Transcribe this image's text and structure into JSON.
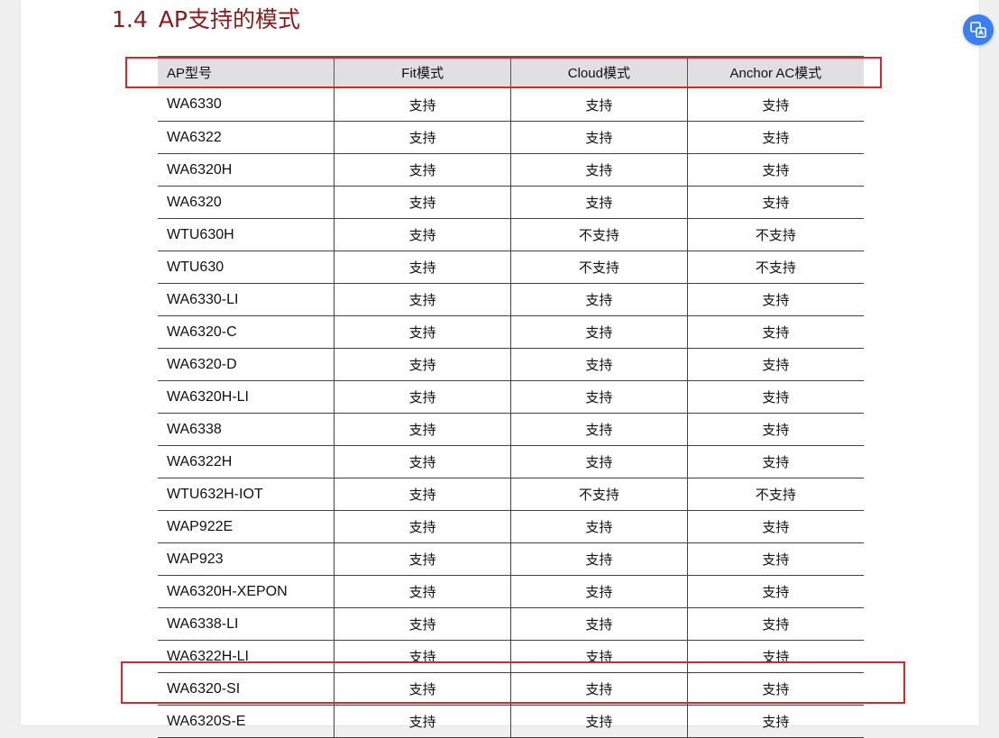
{
  "section": {
    "number": "1.4",
    "title": "AP支持的模式"
  },
  "table": {
    "headers": [
      "AP型号",
      "Fit模式",
      "Cloud模式",
      "Anchor AC模式"
    ],
    "rows": [
      [
        "WA6330",
        "支持",
        "支持",
        "支持"
      ],
      [
        "WA6322",
        "支持",
        "支持",
        "支持"
      ],
      [
        "WA6320H",
        "支持",
        "支持",
        "支持"
      ],
      [
        "WA6320",
        "支持",
        "支持",
        "支持"
      ],
      [
        "WTU630H",
        "支持",
        "不支持",
        "不支持"
      ],
      [
        "WTU630",
        "支持",
        "不支持",
        "不支持"
      ],
      [
        "WA6330-LI",
        "支持",
        "支持",
        "支持"
      ],
      [
        "WA6320-C",
        "支持",
        "支持",
        "支持"
      ],
      [
        "WA6320-D",
        "支持",
        "支持",
        "支持"
      ],
      [
        "WA6320H-LI",
        "支持",
        "支持",
        "支持"
      ],
      [
        "WA6338",
        "支持",
        "支持",
        "支持"
      ],
      [
        "WA6322H",
        "支持",
        "支持",
        "支持"
      ],
      [
        "WTU632H-IOT",
        "支持",
        "不支持",
        "不支持"
      ],
      [
        "WAP922E",
        "支持",
        "支持",
        "支持"
      ],
      [
        "WAP923",
        "支持",
        "支持",
        "支持"
      ],
      [
        "WA6320H-XEPON",
        "支持",
        "支持",
        "支持"
      ],
      [
        "WA6338-LI",
        "支持",
        "支持",
        "支持"
      ],
      [
        "WA6322H-LI",
        "支持",
        "支持",
        "支持"
      ],
      [
        "WA6320-SI",
        "支持",
        "支持",
        "支持"
      ],
      [
        "WA6320S-E",
        "支持",
        "支持",
        "支持"
      ]
    ]
  },
  "floating_button": {
    "icon": "translate-icon"
  },
  "colors": {
    "title": "#8c1a1a",
    "highlight": "#d9262c",
    "fab": "#3a7ff0"
  }
}
